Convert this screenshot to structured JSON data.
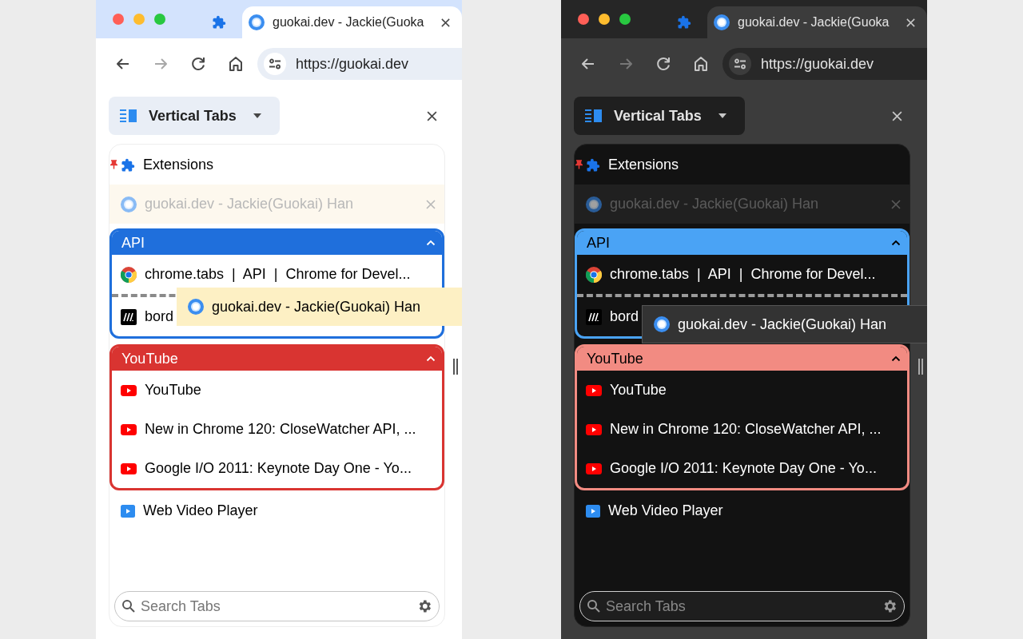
{
  "windows": [
    {
      "kind": "light",
      "tabs": [
        {
          "kind": "extensions",
          "selected": false
        },
        {
          "kind": "page",
          "title": "guokai.dev - Jackie(Guoka",
          "selected": true
        }
      ],
      "nav": [
        {
          "kind": "back",
          "disabled": false
        },
        {
          "kind": "forward",
          "disabled": true
        },
        {
          "kind": "reload",
          "disabled": false
        },
        {
          "kind": "home",
          "disabled": false
        }
      ],
      "address": "https://guokai.dev",
      "sidebar": {
        "title": "Vertical Tabs",
        "items": [
          {
            "kind": "tab",
            "icon": {
              "kind": "extensions"
            },
            "title": "Extensions",
            "pinned": true,
            "dragging": false
          },
          {
            "kind": "tab",
            "icon": {
              "kind": "guokai"
            },
            "title": "guokai.dev - Jackie(Guokai) Han",
            "pinned": false,
            "dragging": true
          },
          {
            "kind": "group",
            "title": "API",
            "color": "#1f6fdc",
            "expanded": true,
            "children": [
              {
                "icon": {
                  "kind": "chrome"
                },
                "title": "chrome.tabs  |  API  |  Chrome for Devel...",
                "drop_before": false
              },
              {
                "icon": {
                  "kind": "mdn"
                },
                "title": "bord",
                "drop_before": true
              }
            ]
          },
          {
            "kind": "group",
            "title": "YouTube",
            "color": "#d93431",
            "expanded": true,
            "children": [
              {
                "icon": {
                  "kind": "youtube"
                },
                "title": "YouTube",
                "drop_before": false
              },
              {
                "icon": {
                  "kind": "youtube"
                },
                "title": "New in Chrome 120: CloseWatcher API, ...",
                "drop_before": false
              },
              {
                "icon": {
                  "kind": "youtube"
                },
                "title": "Google I/O 2011: Keynote Day One - Yo...",
                "drop_before": false
              }
            ]
          },
          {
            "kind": "tab",
            "icon": {
              "kind": "video"
            },
            "title": "Web Video Player",
            "pinned": false,
            "dragging": false
          }
        ],
        "drag_ghost": {
          "icon": {
            "kind": "guokai"
          },
          "title": "guokai.dev - Jackie(Guokai) Han"
        },
        "search": {
          "placeholder": "Search Tabs"
        }
      }
    },
    {
      "kind": "dark",
      "tabs": [
        {
          "kind": "extensions",
          "selected": false
        },
        {
          "kind": "page",
          "title": "guokai.dev - Jackie(Guoka",
          "selected": true
        }
      ],
      "nav": [
        {
          "kind": "back",
          "disabled": false
        },
        {
          "kind": "forward",
          "disabled": true
        },
        {
          "kind": "reload",
          "disabled": false
        },
        {
          "kind": "home",
          "disabled": false
        }
      ],
      "address": "https://guokai.dev",
      "sidebar": {
        "title": "Vertical Tabs",
        "items": [
          {
            "kind": "tab",
            "icon": {
              "kind": "extensions"
            },
            "title": "Extensions",
            "pinned": true,
            "dragging": false
          },
          {
            "kind": "tab",
            "icon": {
              "kind": "guokai"
            },
            "title": "guokai.dev - Jackie(Guokai) Han",
            "pinned": false,
            "dragging": true
          },
          {
            "kind": "group",
            "title": "API",
            "color": "#4aa3f5",
            "expanded": true,
            "children": [
              {
                "icon": {
                  "kind": "chrome"
                },
                "title": "chrome.tabs  |  API  |  Chrome for Devel...",
                "drop_before": false
              },
              {
                "icon": {
                  "kind": "mdn"
                },
                "title": "bord",
                "drop_before": true
              }
            ]
          },
          {
            "kind": "group",
            "title": "YouTube",
            "color": "#f28b82",
            "expanded": true,
            "children": [
              {
                "icon": {
                  "kind": "youtube"
                },
                "title": "YouTube",
                "drop_before": false
              },
              {
                "icon": {
                  "kind": "youtube"
                },
                "title": "New in Chrome 120: CloseWatcher API, ...",
                "drop_before": false
              },
              {
                "icon": {
                  "kind": "youtube"
                },
                "title": "Google I/O 2011: Keynote Day One - Yo...",
                "drop_before": false
              }
            ]
          },
          {
            "kind": "tab",
            "icon": {
              "kind": "video"
            },
            "title": "Web Video Player",
            "pinned": false,
            "dragging": false
          }
        ],
        "drag_ghost": {
          "icon": {
            "kind": "guokai"
          },
          "title": "guokai.dev - Jackie(Guokai) Han"
        },
        "search": {
          "placeholder": "Search Tabs"
        }
      }
    }
  ]
}
